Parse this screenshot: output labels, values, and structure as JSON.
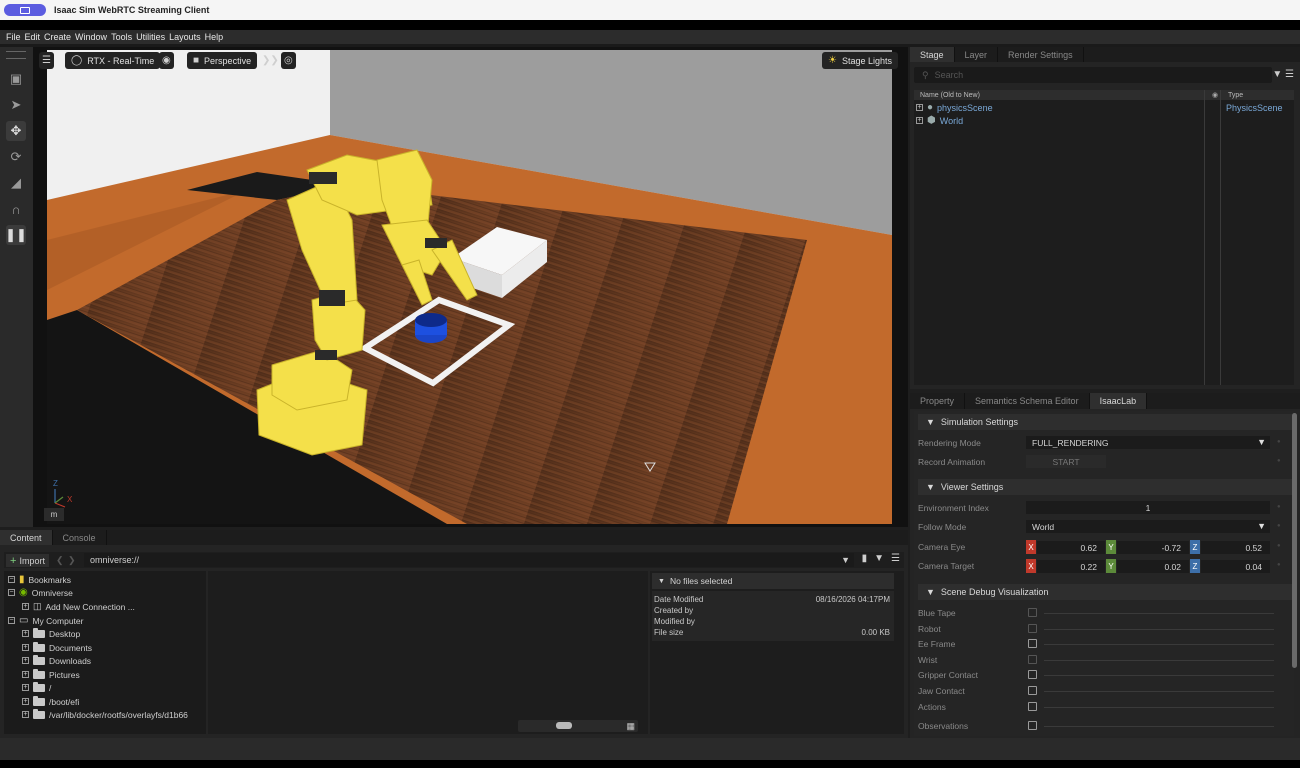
{
  "window": {
    "title": "Isaac Sim WebRTC Streaming Client"
  },
  "menu": [
    "File",
    "Edit",
    "Create",
    "Window",
    "Tools",
    "Utilities",
    "Layouts",
    "Help"
  ],
  "viewport": {
    "render_mode": "RTX - Real-Time",
    "camera": "Perspective",
    "stage_lights": "Stage Lights",
    "axis_z": "Z",
    "axis_x": "X",
    "badge": "m"
  },
  "stage": {
    "tabs": [
      "Stage",
      "Layer",
      "Render Settings"
    ],
    "search_placeholder": "Search",
    "col_name": "Name (Old to New)",
    "col_type": "Type",
    "items": [
      {
        "name": "physicsScene",
        "type": "PhysicsScene"
      },
      {
        "name": "World",
        "type": ""
      }
    ]
  },
  "property": {
    "tabs": [
      "Property",
      "Semantics Schema Editor",
      "IsaacLab"
    ],
    "simulation": {
      "title": "Simulation Settings",
      "rendering_mode_label": "Rendering Mode",
      "rendering_mode": "FULL_RENDERING",
      "record_label": "Record Animation",
      "record_button": "START"
    },
    "viewer": {
      "title": "Viewer Settings",
      "env_index_label": "Environment Index",
      "env_index": "1",
      "follow_label": "Follow Mode",
      "follow_mode": "World",
      "eye_label": "Camera Eye",
      "eye": {
        "x": "0.62",
        "y": "-0.72",
        "z": "0.52"
      },
      "target_label": "Camera Target",
      "target": {
        "x": "0.22",
        "y": "0.02",
        "z": "0.04"
      }
    },
    "debug": {
      "title": "Scene Debug Visualization",
      "items": [
        "Blue Tape",
        "Robot",
        "Ee Frame",
        "Wrist",
        "Gripper Contact",
        "Jaw Contact",
        "Actions",
        "Observations"
      ]
    },
    "axis_labels": {
      "x": "X",
      "y": "Y",
      "z": "Z"
    },
    "colors": {
      "x": "#c0392b",
      "y": "#5c8a3a",
      "z": "#3d6fa8"
    }
  },
  "content": {
    "tabs": [
      "Content",
      "Console"
    ],
    "import_label": "Import",
    "path": "omniverse://",
    "tree": [
      {
        "label": "Bookmarks",
        "indent": 0,
        "icon": "bookmark"
      },
      {
        "label": "Omniverse",
        "indent": 0,
        "icon": "omniverse"
      },
      {
        "label": "Add New Connection ...",
        "indent": 1,
        "icon": "connection"
      },
      {
        "label": "My Computer",
        "indent": 0,
        "icon": "computer"
      },
      {
        "label": "Desktop",
        "indent": 1,
        "icon": "folder"
      },
      {
        "label": "Documents",
        "indent": 1,
        "icon": "folder"
      },
      {
        "label": "Downloads",
        "indent": 1,
        "icon": "folder"
      },
      {
        "label": "Pictures",
        "indent": 1,
        "icon": "folder"
      },
      {
        "label": "/",
        "indent": 1,
        "icon": "folder"
      },
      {
        "label": "/boot/efi",
        "indent": 1,
        "icon": "folder"
      },
      {
        "label": "/var/lib/docker/rootfs/overlayfs/d1b66",
        "indent": 1,
        "icon": "folder"
      }
    ],
    "info": {
      "header": "No files selected",
      "date_modified_label": "Date Modified",
      "date_modified": "08/16/2026 04:17PM",
      "created_by_label": "Created by",
      "modified_by_label": "Modified by",
      "file_size_label": "File size",
      "file_size": "0.00 KB"
    }
  }
}
